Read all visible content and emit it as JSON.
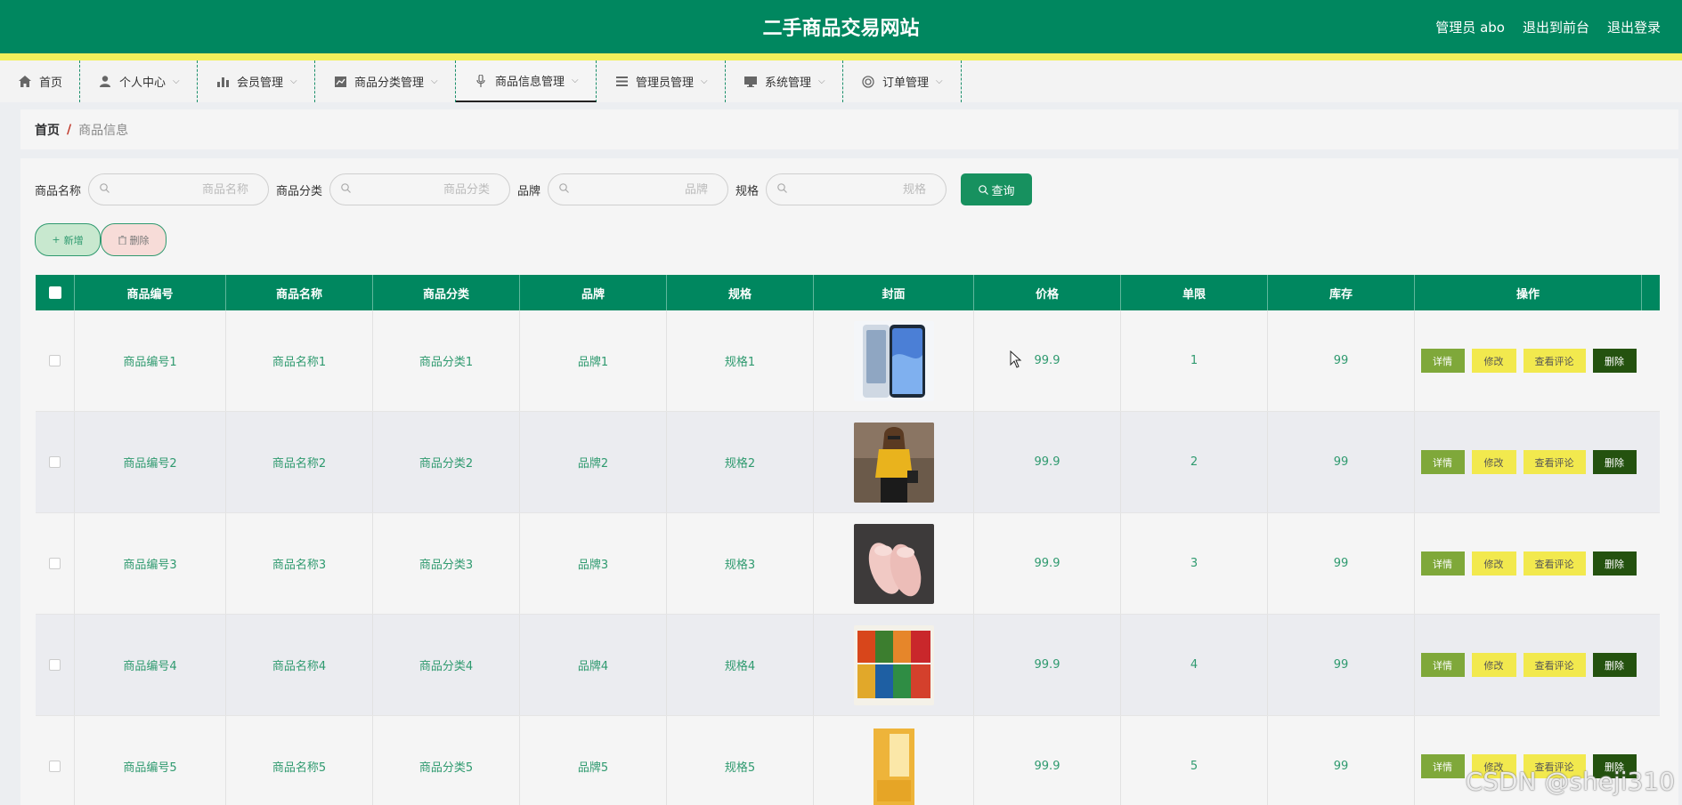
{
  "header": {
    "title": "二手商品交易网站",
    "links": [
      "管理员 abo",
      "退出到前台",
      "退出登录"
    ]
  },
  "nav": {
    "items": [
      {
        "label": "首页",
        "icon": "home-icon"
      },
      {
        "label": "个人中心",
        "icon": "user-icon"
      },
      {
        "label": "会员管理",
        "icon": "bar-chart-icon"
      },
      {
        "label": "商品分类管理",
        "icon": "line-chart-icon"
      },
      {
        "label": "商品信息管理",
        "icon": "microphone-icon"
      },
      {
        "label": "管理员管理",
        "icon": "list-icon"
      },
      {
        "label": "系统管理",
        "icon": "monitor-icon"
      },
      {
        "label": "订单管理",
        "icon": "circle-icon"
      }
    ],
    "active_index": 4
  },
  "breadcrumb": {
    "home": "首页",
    "separator": "/",
    "current": "商品信息"
  },
  "search": {
    "fields": [
      {
        "label": "商品名称",
        "placeholder": "商品名称"
      },
      {
        "label": "商品分类",
        "placeholder": "商品分类"
      },
      {
        "label": "品牌",
        "placeholder": "品牌"
      },
      {
        "label": "规格",
        "placeholder": "规格"
      }
    ],
    "button_label": "查询"
  },
  "actions": {
    "add_label": "新增",
    "delete_label": "删除"
  },
  "table": {
    "headers": [
      "商品编号",
      "商品名称",
      "商品分类",
      "品牌",
      "规格",
      "封面",
      "价格",
      "单限",
      "库存",
      "操作"
    ],
    "rows": [
      {
        "code": "商品编号1",
        "name": "商品名称1",
        "category": "商品分类1",
        "brand": "品牌1",
        "spec": "规格1",
        "cover": "phone-image",
        "price": "99.9",
        "limit": "1",
        "stock": "99"
      },
      {
        "code": "商品编号2",
        "name": "商品名称2",
        "category": "商品分类2",
        "brand": "品牌2",
        "spec": "规格2",
        "cover": "woman-yellow-top-image",
        "price": "99.9",
        "limit": "2",
        "stock": "99"
      },
      {
        "code": "商品编号3",
        "name": "商品名称3",
        "category": "商品分类3",
        "brand": "品牌3",
        "spec": "规格3",
        "cover": "pink-shoes-image",
        "price": "99.9",
        "limit": "3",
        "stock": "99"
      },
      {
        "code": "商品编号4",
        "name": "商品名称4",
        "category": "商品分类4",
        "brand": "品牌4",
        "spec": "规格4",
        "cover": "snack-packs-image",
        "price": "99.9",
        "limit": "4",
        "stock": "99"
      },
      {
        "code": "商品编号5",
        "name": "商品名称5",
        "category": "商品分类5",
        "brand": "品牌5",
        "spec": "规格5",
        "cover": "yellow-book-image",
        "price": "99.9",
        "limit": "5",
        "stock": "99"
      }
    ],
    "row_actions": {
      "detail": "详情",
      "edit": "修改",
      "review": "查看评论",
      "remove": "删除"
    }
  },
  "watermark": "CSDN @sheji310",
  "colors": {
    "primary": "#00875f",
    "accent_yellow": "#f2f05b",
    "link_green": "#2f9a6f",
    "detail_btn": "#7fa83a",
    "remove_btn": "#24520f"
  }
}
